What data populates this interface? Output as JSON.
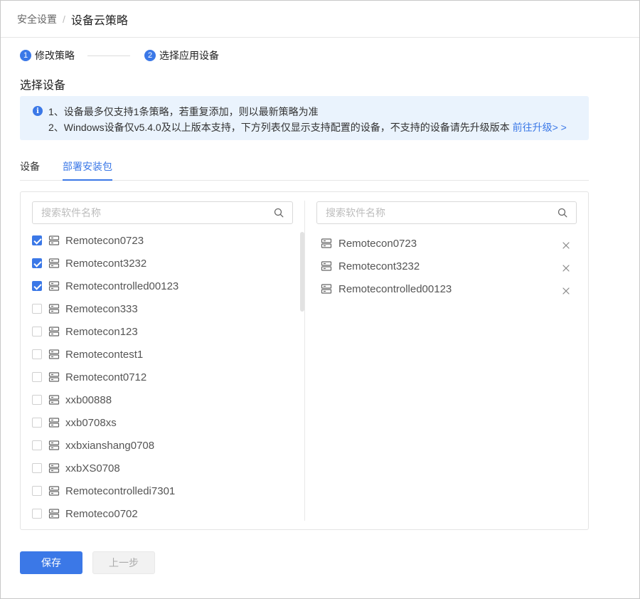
{
  "breadcrumb": {
    "parent": "安全设置",
    "separator": "/",
    "current": "设备云策略"
  },
  "steps": [
    {
      "num": "1",
      "label": "修改策略"
    },
    {
      "num": "2",
      "label": "选择应用设备"
    }
  ],
  "section_title": "选择设备",
  "notice": {
    "line1": "1、设备最多仅支持1条策略，若重复添加，则以最新策略为准",
    "line2": "2、Windows设备仅v5.4.0及以上版本支持，下方列表仅显示支持配置的设备，不支持的设备请先升级版本",
    "link": "前往升级> >"
  },
  "tabs": [
    {
      "label": "设备",
      "active": false
    },
    {
      "label": "部署安装包",
      "active": true
    }
  ],
  "left_panel": {
    "search_placeholder": "搜索软件名称",
    "items": [
      {
        "label": "Remotecon0723",
        "checked": true
      },
      {
        "label": "Remotecont3232",
        "checked": true
      },
      {
        "label": "Remotecontrolled00123",
        "checked": true
      },
      {
        "label": "Remotecon333",
        "checked": false
      },
      {
        "label": "Remotecon123",
        "checked": false
      },
      {
        "label": "Remotecontest1",
        "checked": false
      },
      {
        "label": "Remotecont0712",
        "checked": false
      },
      {
        "label": "xxb00888",
        "checked": false
      },
      {
        "label": "xxb0708xs",
        "checked": false
      },
      {
        "label": "xxbxianshang0708",
        "checked": false
      },
      {
        "label": "xxbXS0708",
        "checked": false
      },
      {
        "label": "Remotecontrolledi7301",
        "checked": false
      },
      {
        "label": "Remoteco0702",
        "checked": false
      }
    ]
  },
  "right_panel": {
    "search_placeholder": "搜索软件名称",
    "items": [
      {
        "label": "Remotecon0723"
      },
      {
        "label": "Remotecont3232"
      },
      {
        "label": "Remotecontrolled00123"
      }
    ]
  },
  "buttons": {
    "save": "保存",
    "prev": "上一步"
  },
  "colors": {
    "primary": "#3b78e7",
    "notice_bg": "#eaf3fd"
  }
}
